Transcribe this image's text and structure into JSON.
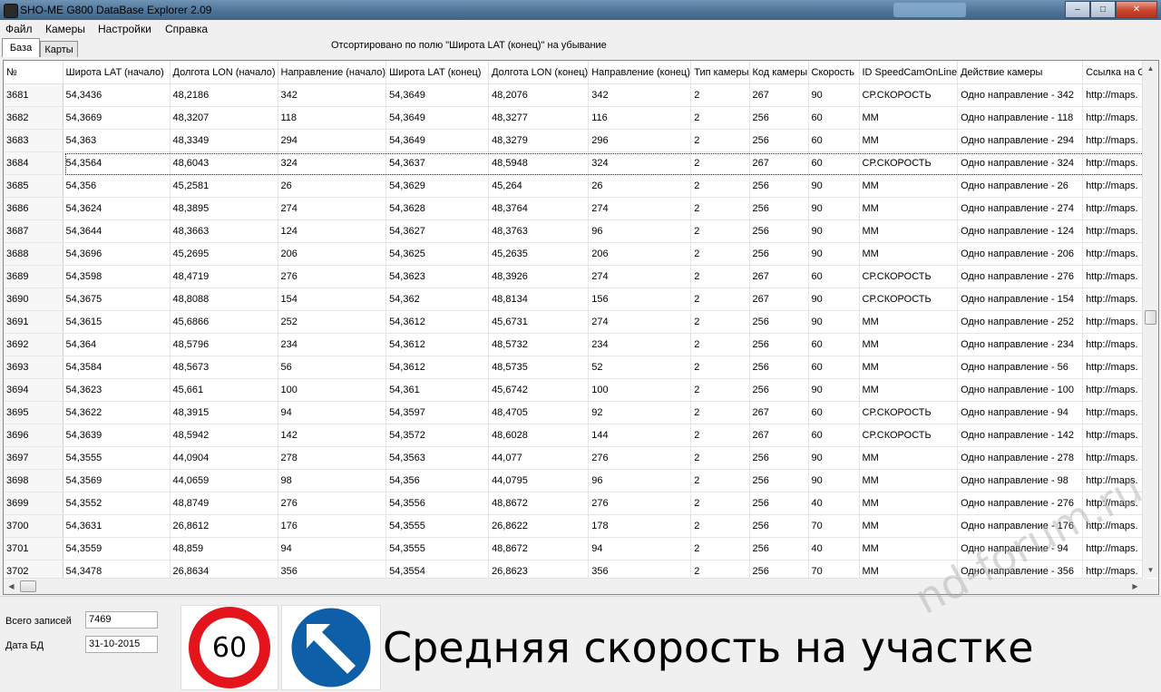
{
  "window": {
    "title": "SHO-ME G800 DataBase Explorer 2.09",
    "minimize": "–",
    "maximize": "□",
    "close": "✕"
  },
  "menu": [
    "Файл",
    "Камеры",
    "Настройки",
    "Справка"
  ],
  "tabs": [
    {
      "label": "База",
      "active": true
    },
    {
      "label": "Карты",
      "active": false
    }
  ],
  "sort_info": "Отсортировано по полю \"Широта LAT (конец)\" на убывание",
  "grid": {
    "columns": [
      "№",
      "Широта LAT (начало)",
      "Долгота LON (начало)",
      "Направление (начало)",
      "Широта LAT (конец)",
      "Долгота LON (конец)",
      "Направление (конец)",
      "Тип камеры",
      "Код камеры",
      "Скорость",
      "ID SpeedCamOnLine",
      "Действие камеры",
      "Ссылка на G"
    ],
    "selected_row": 3,
    "rows": [
      [
        "3681",
        "54,3436",
        "48,2186",
        "342",
        "54,3649",
        "48,2076",
        "342",
        "2",
        "267",
        "90",
        "СР.СКОРОСТЬ",
        "Одно направление - 342",
        "http://maps."
      ],
      [
        "3682",
        "54,3669",
        "48,3207",
        "118",
        "54,3649",
        "48,3277",
        "116",
        "2",
        "256",
        "60",
        "ММ",
        "Одно направление - 118",
        "http://maps."
      ],
      [
        "3683",
        "54,363",
        "48,3349",
        "294",
        "54,3649",
        "48,3279",
        "296",
        "2",
        "256",
        "60",
        "ММ",
        "Одно направление - 294",
        "http://maps."
      ],
      [
        "3684",
        "54,3564",
        "48,6043",
        "324",
        "54,3637",
        "48,5948",
        "324",
        "2",
        "267",
        "60",
        "СР.СКОРОСТЬ",
        "Одно направление - 324",
        "http://maps."
      ],
      [
        "3685",
        "54,356",
        "45,2581",
        "26",
        "54,3629",
        "45,264",
        "26",
        "2",
        "256",
        "90",
        "ММ",
        "Одно направление - 26",
        "http://maps."
      ],
      [
        "3686",
        "54,3624",
        "48,3895",
        "274",
        "54,3628",
        "48,3764",
        "274",
        "2",
        "256",
        "90",
        "ММ",
        "Одно направление - 274",
        "http://maps."
      ],
      [
        "3687",
        "54,3644",
        "48,3663",
        "124",
        "54,3627",
        "48,3763",
        "96",
        "2",
        "256",
        "90",
        "ММ",
        "Одно направление - 124",
        "http://maps."
      ],
      [
        "3688",
        "54,3696",
        "45,2695",
        "206",
        "54,3625",
        "45,2635",
        "206",
        "2",
        "256",
        "90",
        "ММ",
        "Одно направление - 206",
        "http://maps."
      ],
      [
        "3689",
        "54,3598",
        "48,4719",
        "276",
        "54,3623",
        "48,3926",
        "274",
        "2",
        "267",
        "60",
        "СР.СКОРОСТЬ",
        "Одно направление - 276",
        "http://maps."
      ],
      [
        "3690",
        "54,3675",
        "48,8088",
        "154",
        "54,362",
        "48,8134",
        "156",
        "2",
        "267",
        "90",
        "СР.СКОРОСТЬ",
        "Одно направление - 154",
        "http://maps."
      ],
      [
        "3691",
        "54,3615",
        "45,6866",
        "252",
        "54,3612",
        "45,6731",
        "274",
        "2",
        "256",
        "90",
        "ММ",
        "Одно направление - 252",
        "http://maps."
      ],
      [
        "3692",
        "54,364",
        "48,5796",
        "234",
        "54,3612",
        "48,5732",
        "234",
        "2",
        "256",
        "60",
        "ММ",
        "Одно направление - 234",
        "http://maps."
      ],
      [
        "3693",
        "54,3584",
        "48,5673",
        "56",
        "54,3612",
        "48,5735",
        "52",
        "2",
        "256",
        "60",
        "ММ",
        "Одно направление - 56",
        "http://maps."
      ],
      [
        "3694",
        "54,3623",
        "45,661",
        "100",
        "54,361",
        "45,6742",
        "100",
        "2",
        "256",
        "90",
        "ММ",
        "Одно направление - 100",
        "http://maps."
      ],
      [
        "3695",
        "54,3622",
        "48,3915",
        "94",
        "54,3597",
        "48,4705",
        "92",
        "2",
        "267",
        "60",
        "СР.СКОРОСТЬ",
        "Одно направление - 94",
        "http://maps."
      ],
      [
        "3696",
        "54,3639",
        "48,5942",
        "142",
        "54,3572",
        "48,6028",
        "144",
        "2",
        "267",
        "60",
        "СР.СКОРОСТЬ",
        "Одно направление - 142",
        "http://maps."
      ],
      [
        "3697",
        "54,3555",
        "44,0904",
        "278",
        "54,3563",
        "44,077",
        "276",
        "2",
        "256",
        "90",
        "ММ",
        "Одно направление - 278",
        "http://maps."
      ],
      [
        "3698",
        "54,3569",
        "44,0659",
        "98",
        "54,356",
        "44,0795",
        "96",
        "2",
        "256",
        "90",
        "ММ",
        "Одно направление - 98",
        "http://maps."
      ],
      [
        "3699",
        "54,3552",
        "48,8749",
        "276",
        "54,3556",
        "48,8672",
        "276",
        "2",
        "256",
        "40",
        "ММ",
        "Одно направление - 276",
        "http://maps."
      ],
      [
        "3700",
        "54,3631",
        "26,8612",
        "176",
        "54,3555",
        "26,8622",
        "178",
        "2",
        "256",
        "70",
        "ММ",
        "Одно направление - 176",
        "http://maps."
      ],
      [
        "3701",
        "54,3559",
        "48,859",
        "94",
        "54,3555",
        "48,8672",
        "94",
        "2",
        "256",
        "40",
        "ММ",
        "Одно направление - 94",
        "http://maps."
      ],
      [
        "3702",
        "54,3478",
        "26,8634",
        "356",
        "54,3554",
        "26,8623",
        "356",
        "2",
        "256",
        "70",
        "ММ",
        "Одно направление - 356",
        "http://maps."
      ]
    ]
  },
  "bottom": {
    "total_label": "Всего записей",
    "total_value": "7469",
    "date_label": "Дата БД",
    "date_value": "31-10-2015",
    "speed_sign": "60",
    "description": "Средняя скорость на участке",
    "watermark": "nd-forum.ru"
  },
  "colors": {
    "sign_red": "#e3141b",
    "sign_blue": "#0f5fa8",
    "title_bar": "#4d7295"
  },
  "icons": [
    "app-icon",
    "speed-limit-sign-icon",
    "direction-arrow-sign-icon",
    "scroll-up-icon",
    "scroll-down-icon",
    "scroll-left-icon",
    "scroll-right-icon"
  ]
}
